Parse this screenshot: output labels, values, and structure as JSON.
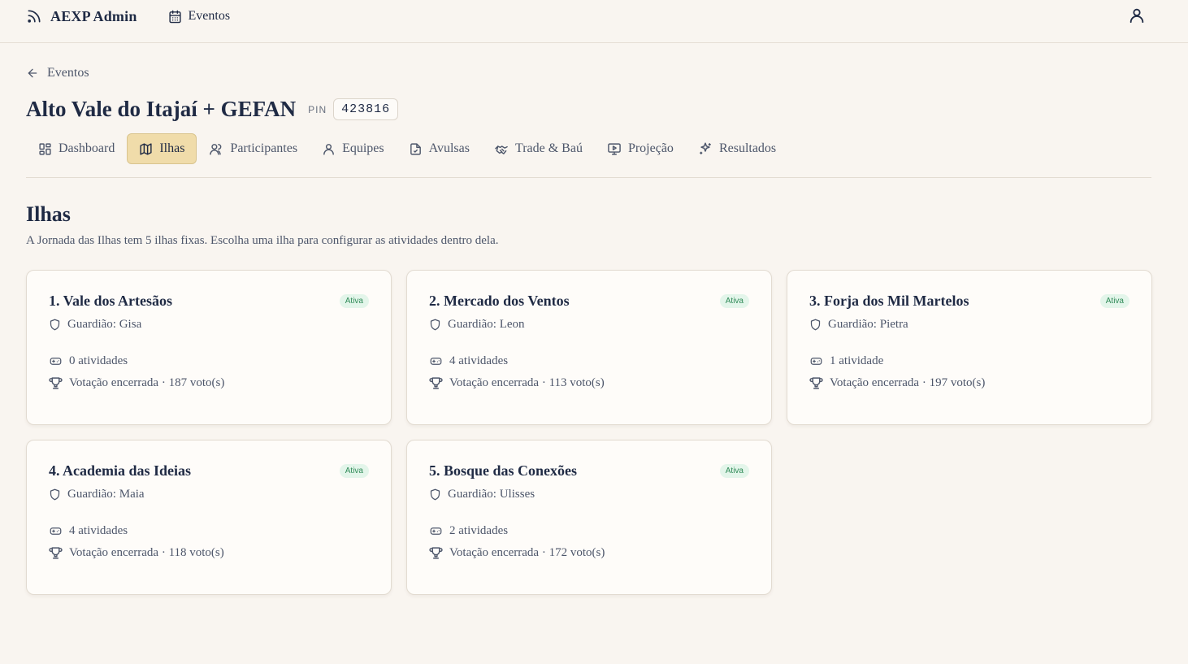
{
  "header": {
    "brand": "AEXP Admin",
    "nav_label": "Eventos",
    "brand_icon": "rss-icon",
    "nav_icon": "calendar-icon",
    "user_icon": "user-icon"
  },
  "breadcrumb": {
    "back_label": "Eventos"
  },
  "event": {
    "title": "Alto Vale do Itajaí + GEFAN",
    "pin_label": "PIN",
    "pin": "423816"
  },
  "tabs": [
    {
      "label": "Dashboard",
      "icon": "dashboard-icon"
    },
    {
      "label": "Ilhas",
      "icon": "map-icon",
      "active": true
    },
    {
      "label": "Participantes",
      "icon": "users-icon"
    },
    {
      "label": "Equipes",
      "icon": "user-icon"
    },
    {
      "label": "Avulsas",
      "icon": "file-icon"
    },
    {
      "label": "Trade & Baú",
      "icon": "handshake-icon"
    },
    {
      "label": "Projeção",
      "icon": "projector-icon"
    },
    {
      "label": "Resultados",
      "icon": "sparkles-icon"
    }
  ],
  "section": {
    "title": "Ilhas",
    "description": "A Jornada das Ilhas tem 5 ilhas fixas. Escolha uma ilha para configurar as atividades dentro dela."
  },
  "islands": [
    {
      "title": "1. Vale dos Artesãos",
      "status": "Ativa",
      "guardian": "Guardião: Gisa",
      "activities": "0 atividades",
      "votes": "Votação encerrada · 187 voto(s)"
    },
    {
      "title": "2. Mercado dos Ventos",
      "status": "Ativa",
      "guardian": "Guardião: Leon",
      "activities": "4 atividades",
      "votes": "Votação encerrada · 113 voto(s)"
    },
    {
      "title": "3. Forja dos Mil Martelos",
      "status": "Ativa",
      "guardian": "Guardião: Pietra",
      "activities": "1 atividade",
      "votes": "Votação encerrada · 197 voto(s)"
    },
    {
      "title": "4. Academia das Ideias",
      "status": "Ativa",
      "guardian": "Guardião: Maia",
      "activities": "4 atividades",
      "votes": "Votação encerrada · 118 voto(s)"
    },
    {
      "title": "5. Bosque das Conexões",
      "status": "Ativa",
      "guardian": "Guardião: Ulisses",
      "activities": "2 atividades",
      "votes": "Votação encerrada · 172 voto(s)"
    }
  ],
  "colors": {
    "background": "#f9f5f0",
    "active_tab": "#f0dcaa",
    "badge_bg": "#e3f5ea",
    "badge_text": "#2f8a57",
    "text": "#1f2a44"
  }
}
